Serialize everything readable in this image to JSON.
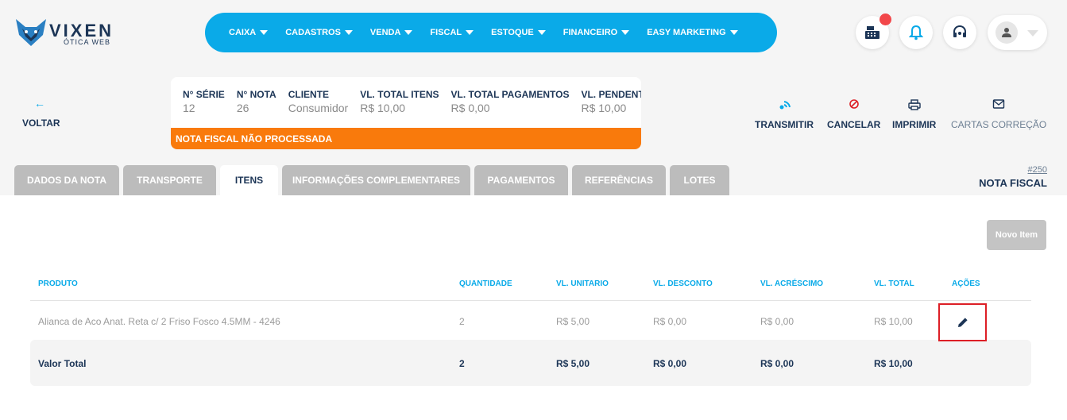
{
  "brand": {
    "name": "VIXEN",
    "subtitle": "ÓTICA WEB"
  },
  "nav": [
    "CAIXA",
    "CADASTROS",
    "VENDA",
    "FISCAL",
    "ESTOQUE",
    "FINANCEIRO",
    "EASY MARKETING"
  ],
  "back_label": "VOLTAR",
  "info": {
    "columns": [
      {
        "label": "N° SÉRIE",
        "value": "12"
      },
      {
        "label": "N° NOTA",
        "value": "26"
      },
      {
        "label": "CLIENTE",
        "value": "Consumidor"
      },
      {
        "label": "VL. TOTAL ITENS",
        "value": "R$ 10,00"
      },
      {
        "label": "VL. TOTAL PAGAMENTOS",
        "value": "R$ 0,00"
      },
      {
        "label": "VL. PENDENTE",
        "value": "R$ 10,00"
      }
    ],
    "status": "NOTA FISCAL NÃO PROCESSADA"
  },
  "actions": {
    "transmit": "TRANSMITIR",
    "cancel": "CANCELAR",
    "print": "IMPRIMIR",
    "letters": "CARTAS CORREÇÃO"
  },
  "tabs": [
    "DADOS DA NOTA",
    "TRANSPORTE",
    "ITENS",
    "INFORMAÇÕES COMPLEMENTARES",
    "PAGAMENTOS",
    "REFERÊNCIAS",
    "LOTES"
  ],
  "active_tab": "ITENS",
  "doc": {
    "number": "#250",
    "title": "NOTA FISCAL"
  },
  "new_item_label": "Novo Item",
  "table": {
    "headers": [
      "PRODUTO",
      "QUANTIDADE",
      "VL. UNITARIO",
      "VL. DESCONTO",
      "VL. ACRÉSCIMO",
      "VL. TOTAL",
      "AÇÕES"
    ],
    "row": [
      "Alianca de Aco Anat. Reta c/ 2 Friso Fosco 4.5MM - 4246",
      "2",
      "R$ 5,00",
      "R$ 0,00",
      "R$ 0,00",
      "R$ 10,00"
    ],
    "total": [
      "Valor Total",
      "2",
      "R$ 5,00",
      "R$ 0,00",
      "R$ 0,00",
      "R$ 10,00"
    ]
  },
  "colors": {
    "accent": "#0aaae8",
    "status": "#f97a0c",
    "highlight": "#dd1f26"
  }
}
